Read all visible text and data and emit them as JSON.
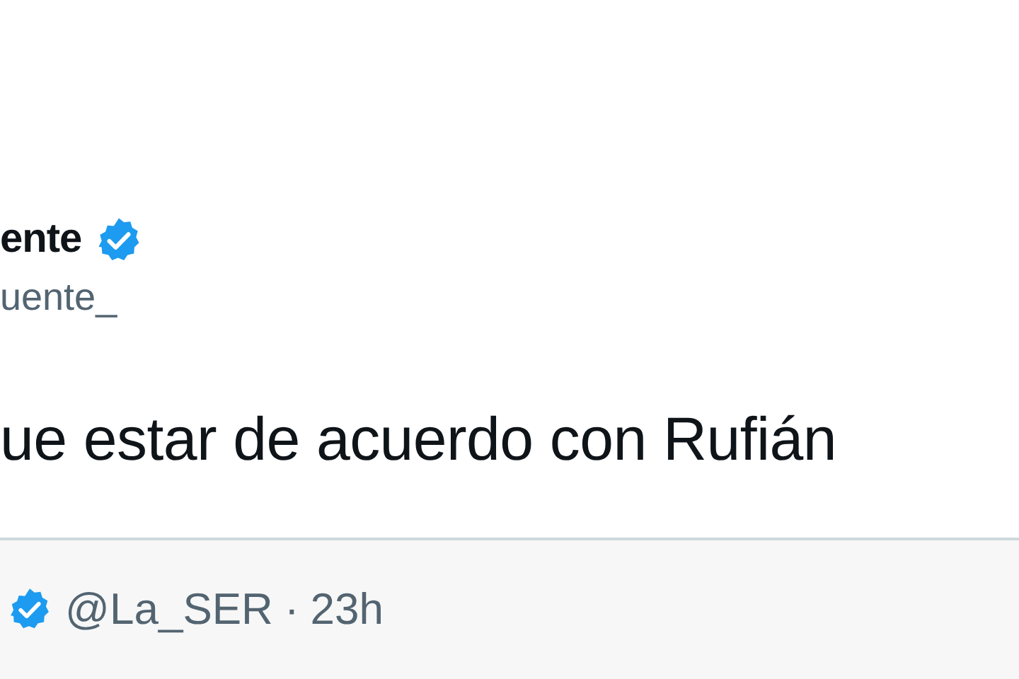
{
  "tweet": {
    "display_name": "ente",
    "verified": true,
    "handle": "uente_",
    "text": "ue estar de acuerdo con Rufián"
  },
  "quoted_tweet": {
    "verified": true,
    "handle": "@La_SER",
    "separator": "·",
    "time": "23h"
  }
}
